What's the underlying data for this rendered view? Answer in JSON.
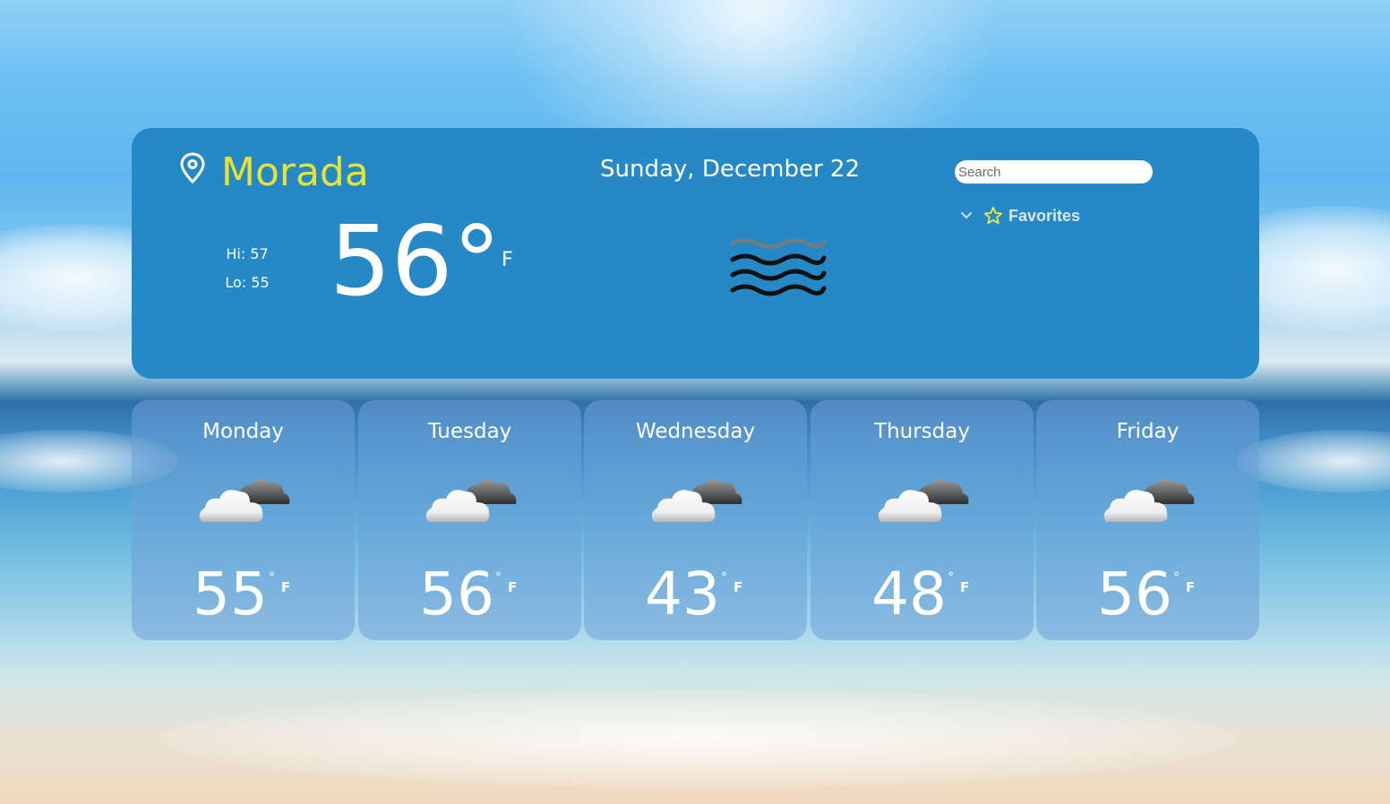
{
  "location": {
    "city": "Morada",
    "icon": "map-pin-icon"
  },
  "current": {
    "date": "Sunday, December 22",
    "hi_label": "Hi: 57",
    "lo_label": "Lo: 55",
    "temp": "56°",
    "unit": "F",
    "condition_icon": "fog-icon"
  },
  "search": {
    "placeholder": "Search"
  },
  "favorites": {
    "label": "Favorites",
    "chevron_icon": "chevron-down-icon",
    "star_icon": "star-icon"
  },
  "forecast": [
    {
      "day": "Monday",
      "temp": "55",
      "unit": "F",
      "icon": "partly-cloudy-icon"
    },
    {
      "day": "Tuesday",
      "temp": "56",
      "unit": "F",
      "icon": "partly-cloudy-icon"
    },
    {
      "day": "Wednesday",
      "temp": "43",
      "unit": "F",
      "icon": "partly-cloudy-icon"
    },
    {
      "day": "Thursday",
      "temp": "48",
      "unit": "F",
      "icon": "partly-cloudy-icon"
    },
    {
      "day": "Friday",
      "temp": "56",
      "unit": "F",
      "icon": "partly-cloudy-icon"
    }
  ],
  "colors": {
    "card": "#2589c7",
    "city": "#e8e234",
    "favorites_text": "#d8e7f2",
    "star": "#f2ef2a"
  }
}
